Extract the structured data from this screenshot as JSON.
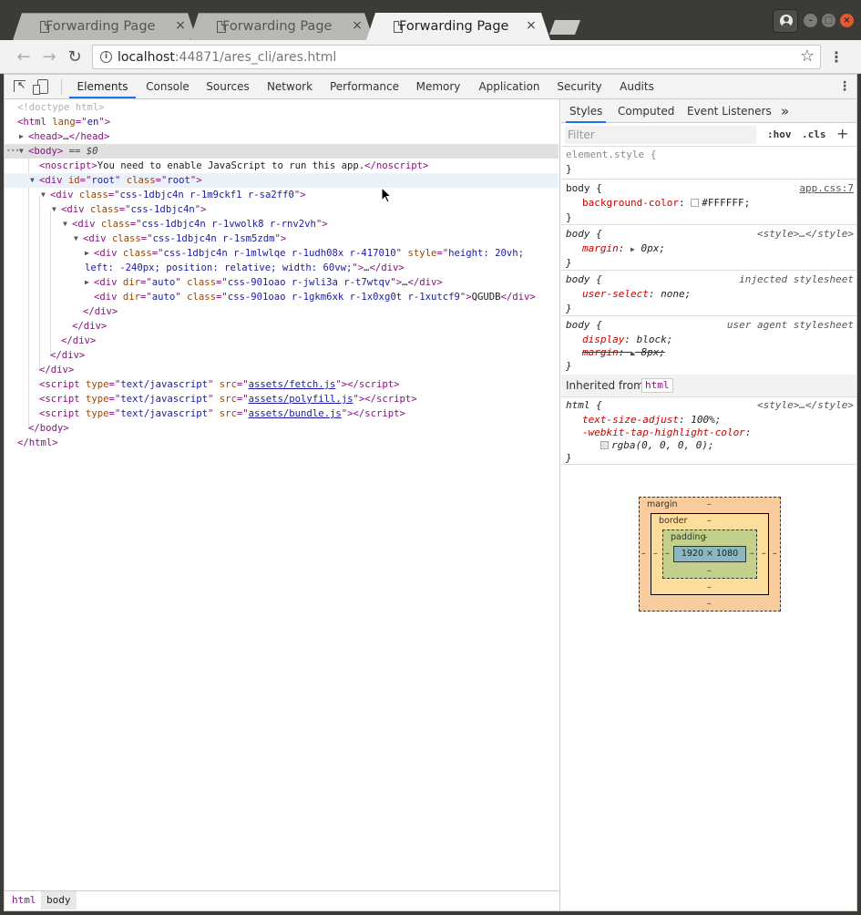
{
  "browser": {
    "tabs": [
      {
        "title": "Forwarding Page",
        "close": "×"
      },
      {
        "title": "Forwarding Page",
        "close": "×"
      },
      {
        "title": "Forwarding Page",
        "close": "×"
      }
    ],
    "window_buttons": {
      "minimize": "–",
      "maximize": "□",
      "close": "×"
    },
    "nav": {
      "back": "←",
      "forward": "→",
      "reload": "↻"
    },
    "url": {
      "host": "localhost",
      "rest": ":44871/ares_cli/ares.html"
    },
    "info_icon": "i",
    "star_icon": "☆",
    "menu_icon": "⋮"
  },
  "devtools": {
    "tabs": [
      "Elements",
      "Console",
      "Sources",
      "Network",
      "Performance",
      "Memory",
      "Application",
      "Security",
      "Audits"
    ],
    "active_tab": "Elements",
    "menu_icon": "⋮",
    "dom": {
      "doctype": "<!doctype html>",
      "html_lang": "en",
      "head_ellipsis": "…",
      "body_marker": "== $0",
      "dots": "•••",
      "noscript_text": "You need to enable JavaScript to run this app.",
      "root_id": "root",
      "root_class": "root",
      "div1_class": "css-1dbjc4n r-1m9ckf1 r-sa2ff0",
      "div2_class": "css-1dbjc4n",
      "div3_class": "css-1dbjc4n r-1vwolk8 r-rnv2vh",
      "div4_class": "css-1dbjc4n r-1sm5zdm",
      "div5_class": "css-1dbjc4n r-1mlwlqe r-1udh08x r-417010",
      "div5_style_a": "height: 20vh;",
      "div5_style_b": "left: -240px; position: relative; width: 60vw;",
      "div6_dir": "auto",
      "div6_class": "css-901oao r-jwli3a r-t7wtqv",
      "div7_dir": "auto",
      "div7_class": "css-901oao r-1gkm6xk r-1x0xg0t r-1xutcf9",
      "div7_text": "QGUDB",
      "script_type": "text/javascript",
      "scripts": [
        "assets/fetch.js",
        "assets/polyfill.js",
        "assets/bundle.js"
      ],
      "ellipsis": "…"
    },
    "breadcrumbs": [
      "html",
      "body"
    ]
  },
  "styles": {
    "tabs": [
      "Styles",
      "Computed",
      "Event Listeners"
    ],
    "more_icon": "»",
    "filter_placeholder": "Filter",
    "hov": ":hov",
    "cls": ".cls",
    "add_icon": "+",
    "rules": {
      "element_style": "element.style {",
      "body_app": {
        "selector": "body {",
        "source": "app.css:7",
        "prop": "background-color",
        "value": "#FFFFFF;"
      },
      "body_style": {
        "selector": "body {",
        "source": "<style>…</style>",
        "prop": "margin",
        "value": "0px;"
      },
      "body_injected": {
        "selector": "body {",
        "source": "injected stylesheet",
        "prop": "user-select",
        "value": "none;"
      },
      "body_ua": {
        "selector": "body {",
        "source": "user agent stylesheet",
        "prop1": "display",
        "value1": "block;",
        "prop2": "margin",
        "value2": "8px;"
      },
      "inherited_label": "Inherited from",
      "inherited_tag": "html",
      "html_style": {
        "selector": "html {",
        "source": "<style>…</style>",
        "prop1": "text-size-adjust",
        "value1": "100%;",
        "prop2": "-webkit-tap-highlight-color",
        "value2": "rgba(0, 0, 0, 0);"
      },
      "brace_close": "}",
      "colon": ":"
    },
    "box_model": {
      "margin_label": "margin",
      "border_label": "border",
      "padding_label": "padding",
      "dash": "–",
      "content": "1920 × 1080"
    }
  },
  "colors": {
    "tag": "#881280",
    "attr_name": "#994500",
    "attr_value": "#1a1aa6",
    "css_prop": "#c80000",
    "active_tab": "#1a73e8"
  }
}
